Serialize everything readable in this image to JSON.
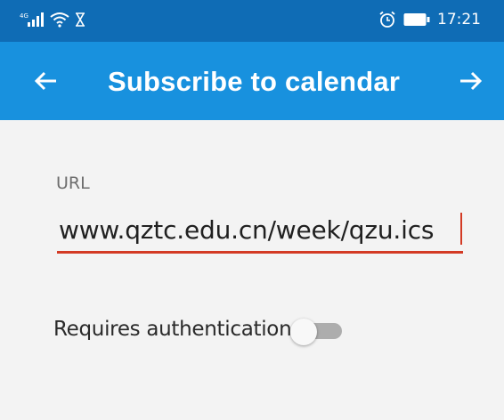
{
  "status_bar": {
    "network_label": "4G",
    "time": "17:21",
    "icons": [
      "signal-icon",
      "wifi-icon",
      "hourglass-icon",
      "alarm-icon",
      "battery-icon"
    ]
  },
  "app_bar": {
    "title": "Subscribe to calendar",
    "back_icon": "arrow-left-icon",
    "next_icon": "arrow-right-icon"
  },
  "form": {
    "url_label": "URL",
    "url_value": "www.qztc.edu.cn/week/qzu.ics",
    "auth_label": "Requires authentication",
    "auth_enabled": false
  },
  "colors": {
    "status_bar": "#0f6cb5",
    "app_bar": "#1891de",
    "background": "#f3f3f3",
    "focus_underline": "#d33a24"
  }
}
